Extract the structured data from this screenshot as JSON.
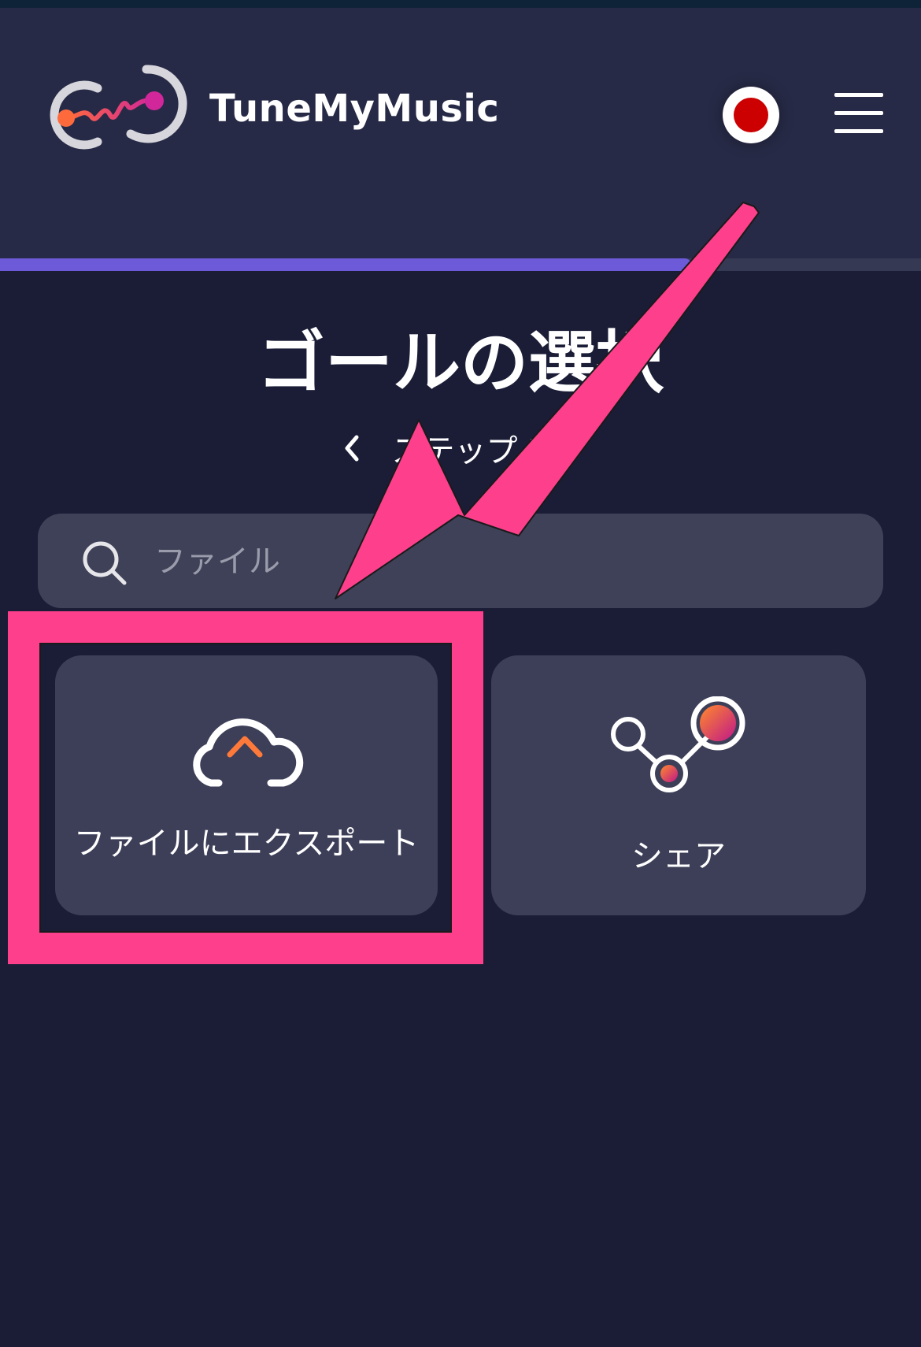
{
  "header": {
    "brand": "TuneMyMusic",
    "logo_icon": "tunemymusic-logo-icon",
    "language_flag": "japan-flag-icon",
    "menu_icon": "hamburger-menu-icon"
  },
  "progress": {
    "percent": 75
  },
  "page": {
    "title": "ゴールの選択",
    "step": "ステップ 3/4"
  },
  "search": {
    "placeholder": "ファイル",
    "value": ""
  },
  "options": [
    {
      "label": "ファイルにエクスポート",
      "icon": "cloud-upload-icon"
    },
    {
      "label": "シェア",
      "icon": "share-nodes-icon"
    }
  ],
  "colors": {
    "background": "#1b1d37",
    "header": "#272a46",
    "card": "#3d3f58",
    "progress": "#6c5ad8",
    "annotation": "#fd3f8c"
  }
}
